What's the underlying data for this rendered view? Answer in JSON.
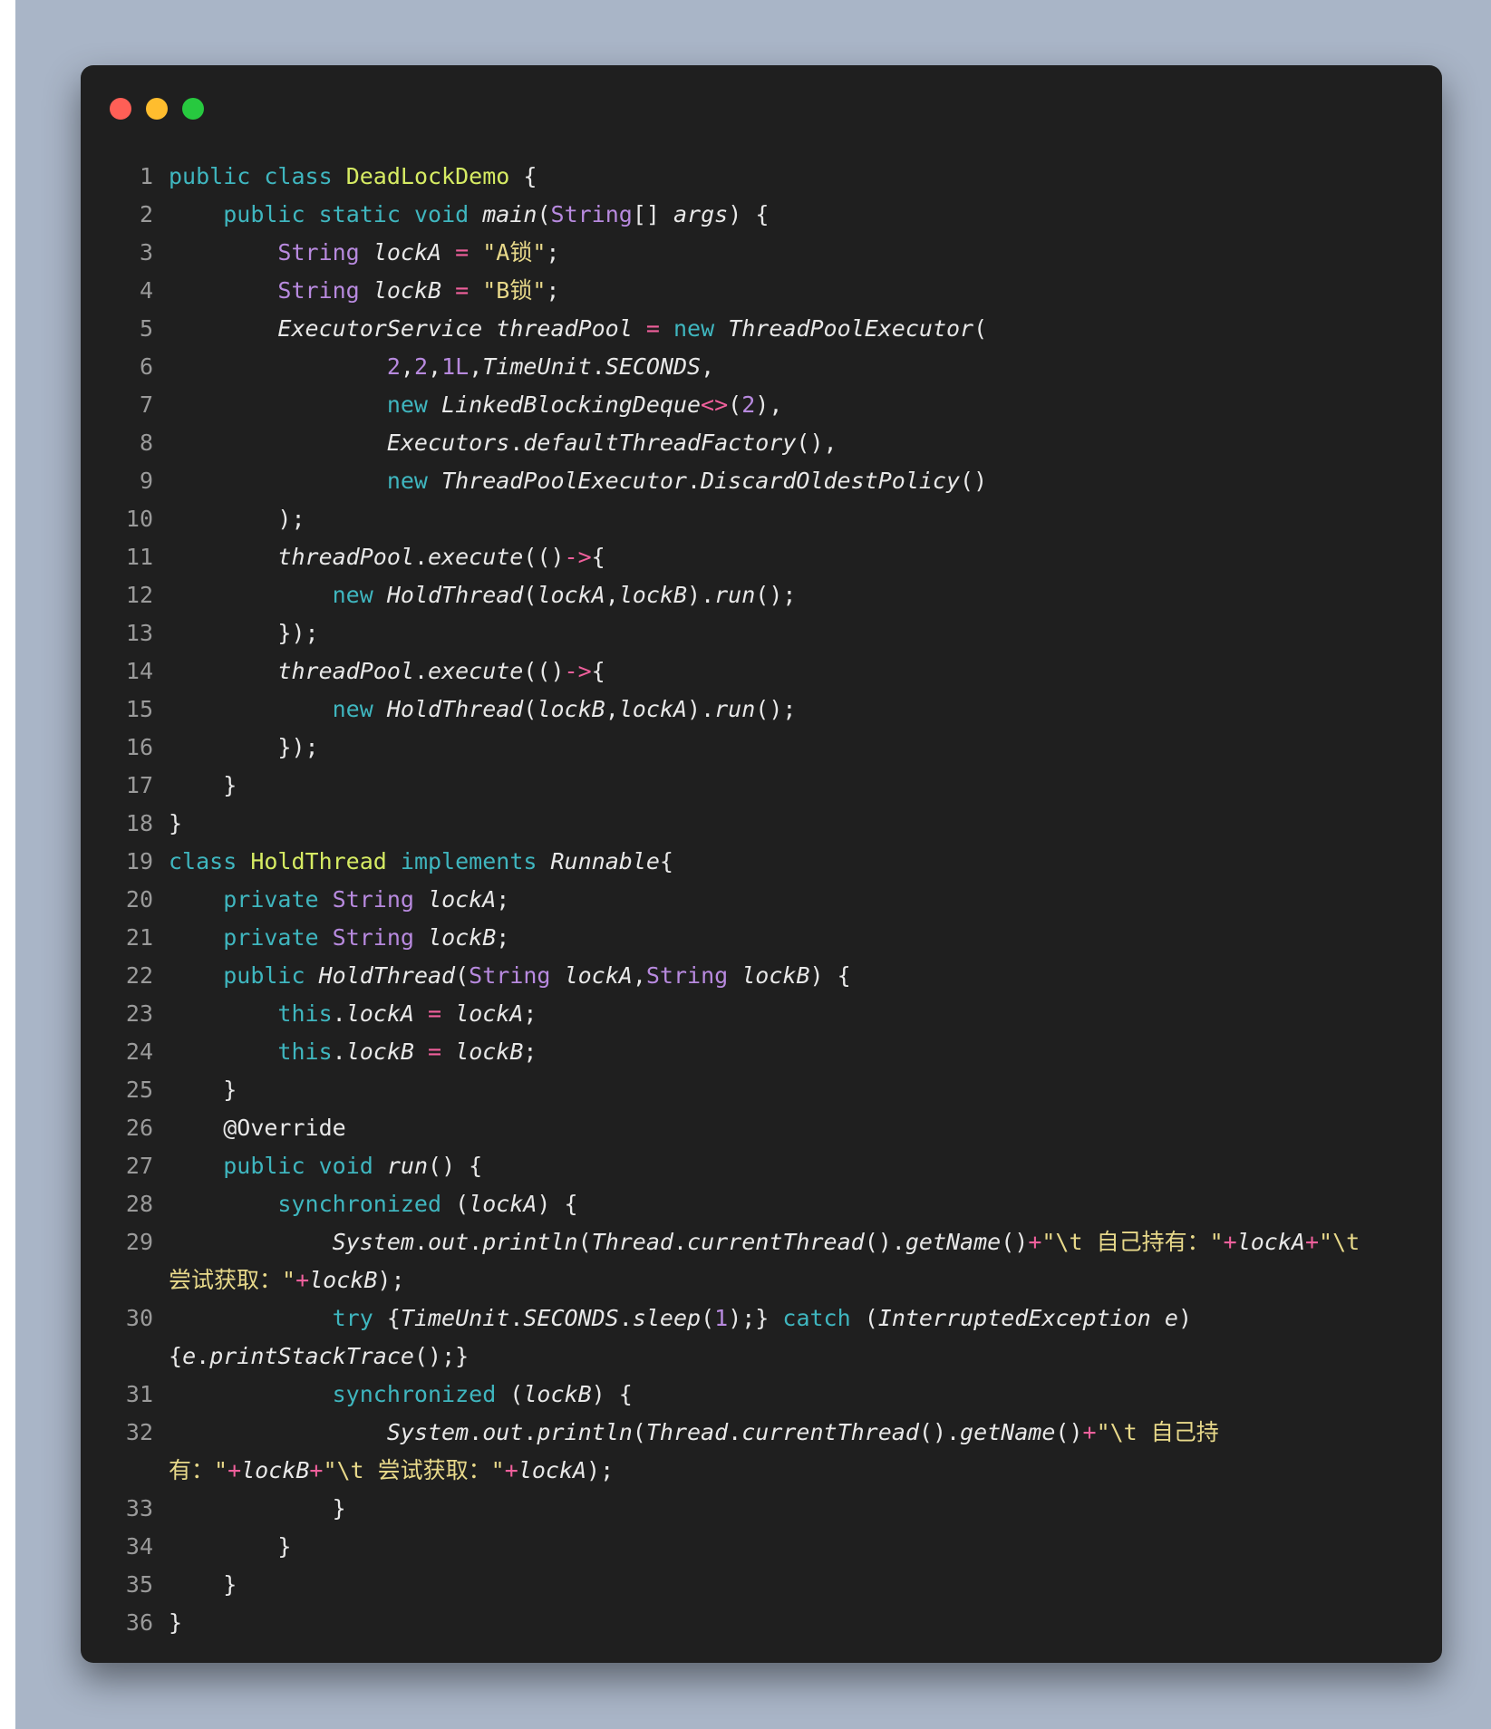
{
  "window": {
    "controls": [
      "close",
      "minimize",
      "maximize"
    ]
  },
  "code": {
    "language": "java",
    "lines": [
      {
        "n": "1",
        "text": "public class DeadLockDemo {"
      },
      {
        "n": "2",
        "text": "    public static void main(String[] args) {"
      },
      {
        "n": "3",
        "text": "        String lockA = \"A锁\";"
      },
      {
        "n": "4",
        "text": "        String lockB = \"B锁\";"
      },
      {
        "n": "5",
        "text": "        ExecutorService threadPool = new ThreadPoolExecutor("
      },
      {
        "n": "6",
        "text": "                2,2,1L,TimeUnit.SECONDS,"
      },
      {
        "n": "7",
        "text": "                new LinkedBlockingDeque<>(2),"
      },
      {
        "n": "8",
        "text": "                Executors.defaultThreadFactory(),"
      },
      {
        "n": "9",
        "text": "                new ThreadPoolExecutor.DiscardOldestPolicy()"
      },
      {
        "n": "10",
        "text": "        );"
      },
      {
        "n": "11",
        "text": "        threadPool.execute(()->{"
      },
      {
        "n": "12",
        "text": "            new HoldThread(lockA,lockB).run();"
      },
      {
        "n": "13",
        "text": "        });"
      },
      {
        "n": "14",
        "text": "        threadPool.execute(()->{"
      },
      {
        "n": "15",
        "text": "            new HoldThread(lockB,lockA).run();"
      },
      {
        "n": "16",
        "text": "        });"
      },
      {
        "n": "17",
        "text": "    }"
      },
      {
        "n": "18",
        "text": "}"
      },
      {
        "n": "19",
        "text": "class HoldThread implements Runnable{"
      },
      {
        "n": "20",
        "text": "    private String lockA;"
      },
      {
        "n": "21",
        "text": "    private String lockB;"
      },
      {
        "n": "22",
        "text": "    public HoldThread(String lockA,String lockB) {"
      },
      {
        "n": "23",
        "text": "        this.lockA = lockA;"
      },
      {
        "n": "24",
        "text": "        this.lockB = lockB;"
      },
      {
        "n": "25",
        "text": "    }"
      },
      {
        "n": "26",
        "text": "    @Override"
      },
      {
        "n": "27",
        "text": "    public void run() {"
      },
      {
        "n": "28",
        "text": "        synchronized (lockA) {"
      },
      {
        "n": "29",
        "text": "            System.out.println(Thread.currentThread().getName()+\"\\t 自己持有：\"+lockA+\"\\t",
        "cont": "尝试获取：\"+lockB);"
      },
      {
        "n": "30",
        "text": "            try {TimeUnit.SECONDS.sleep(1);} catch (InterruptedException e)",
        "cont": "{e.printStackTrace();}"
      },
      {
        "n": "31",
        "text": "            synchronized (lockB) {"
      },
      {
        "n": "32",
        "text": "                System.out.println(Thread.currentThread().getName()+\"\\t 自己持",
        "cont": "有：\"+lockB+\"\\t 尝试获取：\"+lockA);"
      },
      {
        "n": "33",
        "text": "            }"
      },
      {
        "n": "34",
        "text": "        }"
      },
      {
        "n": "35",
        "text": "    }"
      },
      {
        "n": "36",
        "text": "}"
      }
    ]
  },
  "colors": {
    "backdrop": "#a9b5c7",
    "window_bg": "#1f1f1f",
    "line_number": "#9a9a9a",
    "keyword": "#3fb6bf",
    "type": "#b88adf",
    "class_name": "#d6eb63",
    "string": "#e8d98a",
    "operator": "#f0609c",
    "plain": "#e8e8e8"
  }
}
